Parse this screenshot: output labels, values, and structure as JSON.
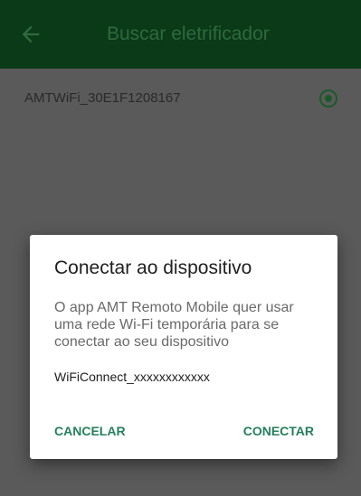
{
  "appbar": {
    "title": "Buscar eletrificador",
    "back_icon": "arrow-left-icon"
  },
  "list": {
    "items": [
      {
        "label": "AMTWiFi_30E1F1208167",
        "selected": true
      }
    ]
  },
  "dialog": {
    "title": "Conectar ao dispositivo",
    "message": "O app AMT Remoto Mobile quer usar uma rede Wi-Fi temporária para se conectar ao seu dispositivo",
    "ssid": "WiFiConnect_xxxxxxxxxxxx",
    "cancel_label": "CANCELAR",
    "connect_label": "CONECTAR"
  },
  "colors": {
    "appbar": "#0b3a18",
    "scrim": "#5a5a5a",
    "accent": "#24805d"
  }
}
